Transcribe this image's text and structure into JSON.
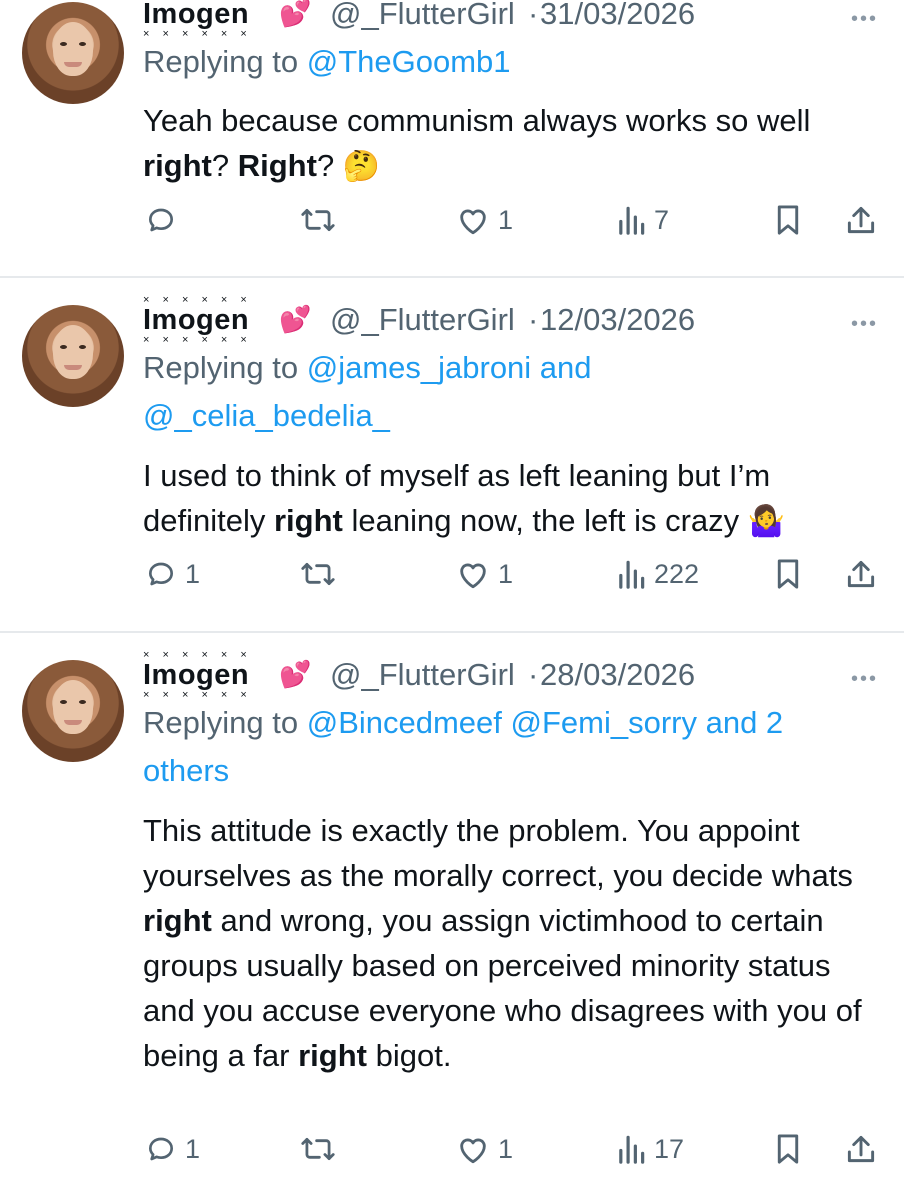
{
  "tweets": [
    {
      "name": "Imogen",
      "heart": "💕",
      "handle": "@_FlutterGirl",
      "date": "31/03/2026",
      "reply_prefix": "Replying to ",
      "reply_to": "@TheGoomb1",
      "reply_to_line2": "",
      "body_parts": [
        "Yeah because communism always works so well ",
        "right",
        "? ",
        "Right",
        "? "
      ],
      "emoji": "🤔",
      "replies": "",
      "likes": "1",
      "views": "7"
    },
    {
      "name": "Imogen",
      "heart": "💕",
      "handle": "@_FlutterGirl",
      "date": "12/03/2026",
      "reply_prefix": "Replying to ",
      "reply_to": "@james_jabroni and",
      "reply_to_line2": "@_celia_bedelia_",
      "body_parts": [
        "I used to think of myself as left leaning but I’m definitely ",
        "right",
        " leaning now, the left is crazy "
      ],
      "emoji": "🤷‍♀️",
      "replies": "1",
      "likes": "1",
      "views": "222"
    },
    {
      "name": "Imogen",
      "heart": "💕",
      "handle": "@_FlutterGirl",
      "date": "28/03/2026",
      "reply_prefix": "Replying to ",
      "reply_to": "@Bincedmeef @Femi_sorry and 2",
      "reply_to_line2": "others",
      "body_parts": [
        "This attitude is exactly the problem. You appoint yourselves as the morally correct, you decide whats ",
        "right",
        " and wrong, you assign victimhood to certain groups usually based on perceived minority status and you accuse everyone who disagrees with you of being a far ",
        "right",
        " bigot."
      ],
      "emoji": "",
      "replies": "1",
      "likes": "1",
      "views": "17"
    }
  ],
  "decor": {
    "name_marks": "× × × × × ×",
    "separator": "·",
    "more": "•••"
  },
  "icons": [
    "reply-icon",
    "retweet-icon",
    "like-icon",
    "views-icon",
    "bookmark-icon",
    "share-icon"
  ],
  "colors": {
    "link": "#1d9bf0",
    "muted": "#536471",
    "text": "#0f1419",
    "divider": "#e6e9ec"
  }
}
